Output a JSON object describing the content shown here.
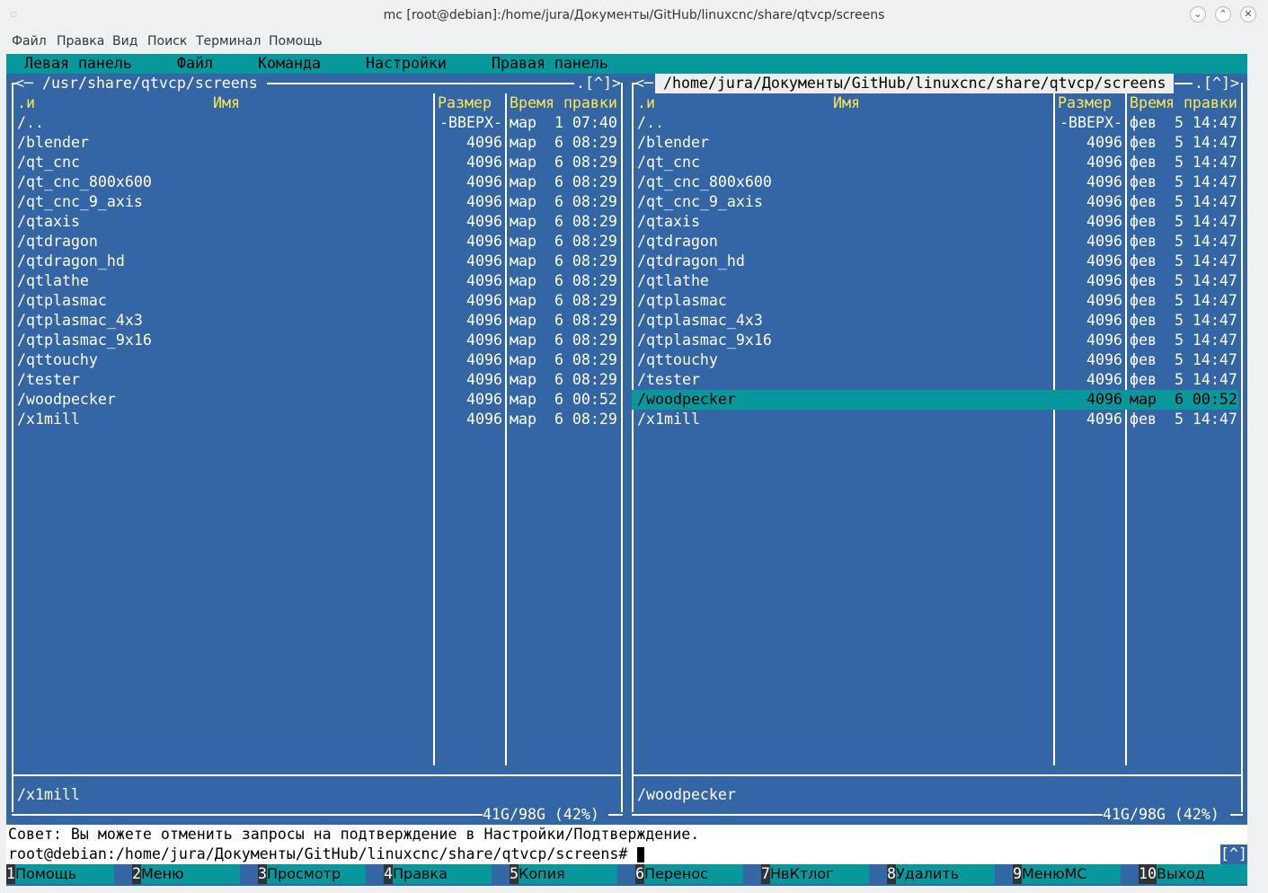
{
  "window": {
    "title": "mc [root@debian]:/home/jura/Документы/GitHub/linuxcnc/share/qtvcp/screens",
    "buttons": [
      "minimize-icon",
      "maximize-icon",
      "close-icon"
    ]
  },
  "menubar": [
    "Файл",
    "Правка",
    "Вид",
    "Поиск",
    "Терминал",
    "Помощь"
  ],
  "mc_menu": [
    "Левая панель",
    "Файл",
    "Команда",
    "Настройки",
    "Правая панель"
  ],
  "left_panel": {
    "path": "/usr/share/qtvcp/screens",
    "corner": ".[^]>",
    "nav": "<─",
    "headers": {
      "sort": ".и",
      "name": "Имя",
      "size": "Размер",
      "time": "Время правки"
    },
    "rows": [
      {
        "name": "/..",
        "size": "-ВВЕРХ-",
        "time": "мар  1 07:40"
      },
      {
        "name": "/blender",
        "size": "4096",
        "time": "мар  6 08:29"
      },
      {
        "name": "/qt_cnc",
        "size": "4096",
        "time": "мар  6 08:29"
      },
      {
        "name": "/qt_cnc_800x600",
        "size": "4096",
        "time": "мар  6 08:29"
      },
      {
        "name": "/qt_cnc_9_axis",
        "size": "4096",
        "time": "мар  6 08:29"
      },
      {
        "name": "/qtaxis",
        "size": "4096",
        "time": "мар  6 08:29"
      },
      {
        "name": "/qtdragon",
        "size": "4096",
        "time": "мар  6 08:29"
      },
      {
        "name": "/qtdragon_hd",
        "size": "4096",
        "time": "мар  6 08:29"
      },
      {
        "name": "/qtlathe",
        "size": "4096",
        "time": "мар  6 08:29"
      },
      {
        "name": "/qtplasmac",
        "size": "4096",
        "time": "мар  6 08:29"
      },
      {
        "name": "/qtplasmac_4x3",
        "size": "4096",
        "time": "мар  6 08:29"
      },
      {
        "name": "/qtplasmac_9x16",
        "size": "4096",
        "time": "мар  6 08:29"
      },
      {
        "name": "/qttouchy",
        "size": "4096",
        "time": "мар  6 08:29"
      },
      {
        "name": "/tester",
        "size": "4096",
        "time": "мар  6 08:29"
      },
      {
        "name": "/woodpecker",
        "size": "4096",
        "time": "мар  6 00:52"
      },
      {
        "name": "/x1mill",
        "size": "4096",
        "time": "мар  6 08:29"
      }
    ],
    "status": "/x1mill",
    "disk": "41G/98G (42%)"
  },
  "right_panel": {
    "path": "/home/jura/Документы/GitHub/linuxcnc/share/qtvcp/screens",
    "corner": ".[^]>",
    "nav": "<─",
    "headers": {
      "sort": ".и",
      "name": "Имя",
      "size": "Размер",
      "time": "Время правки"
    },
    "rows": [
      {
        "name": "/..",
        "size": "-ВВЕРХ-",
        "time": "фев  5 14:47"
      },
      {
        "name": "/blender",
        "size": "4096",
        "time": "фев  5 14:47"
      },
      {
        "name": "/qt_cnc",
        "size": "4096",
        "time": "фев  5 14:47"
      },
      {
        "name": "/qt_cnc_800x600",
        "size": "4096",
        "time": "фев  5 14:47"
      },
      {
        "name": "/qt_cnc_9_axis",
        "size": "4096",
        "time": "фев  5 14:47"
      },
      {
        "name": "/qtaxis",
        "size": "4096",
        "time": "фев  5 14:47"
      },
      {
        "name": "/qtdragon",
        "size": "4096",
        "time": "фев  5 14:47"
      },
      {
        "name": "/qtdragon_hd",
        "size": "4096",
        "time": "фев  5 14:47"
      },
      {
        "name": "/qtlathe",
        "size": "4096",
        "time": "фев  5 14:47"
      },
      {
        "name": "/qtplasmac",
        "size": "4096",
        "time": "фев  5 14:47"
      },
      {
        "name": "/qtplasmac_4x3",
        "size": "4096",
        "time": "фев  5 14:47"
      },
      {
        "name": "/qtplasmac_9x16",
        "size": "4096",
        "time": "фев  5 14:47"
      },
      {
        "name": "/qttouchy",
        "size": "4096",
        "time": "фев  5 14:47"
      },
      {
        "name": "/tester",
        "size": "4096",
        "time": "фев  5 14:47"
      },
      {
        "name": "/woodpecker",
        "size": "4096",
        "time": "мар  6 00:52",
        "selected": true
      },
      {
        "name": "/x1mill",
        "size": "4096",
        "time": "фев  5 14:47"
      }
    ],
    "status": "/woodpecker",
    "disk": "41G/98G (42%)"
  },
  "hint": "Совет: Вы можете отменить запросы на подтверждение в Настройки/Подтверждение.",
  "prompt": "root@debian:/home/jura/Документы/GitHub/linuxcnc/share/qtvcp/screens#",
  "history_btn": "[^]",
  "fkeys": [
    {
      "num": "1",
      "label": "Помощь"
    },
    {
      "num": "2",
      "label": "Меню"
    },
    {
      "num": "3",
      "label": "Просмотр"
    },
    {
      "num": "4",
      "label": "Правка"
    },
    {
      "num": "5",
      "label": "Копия"
    },
    {
      "num": "6",
      "label": "Перенос"
    },
    {
      "num": "7",
      "label": "НвКтлог"
    },
    {
      "num": "8",
      "label": "Удалить"
    },
    {
      "num": "9",
      "label": "МенюМС"
    },
    {
      "num": "10",
      "label": "Выход"
    }
  ],
  "colors": {
    "panel_bg": "#3465a4",
    "accent": "#06989a",
    "header": "#fce94f"
  }
}
